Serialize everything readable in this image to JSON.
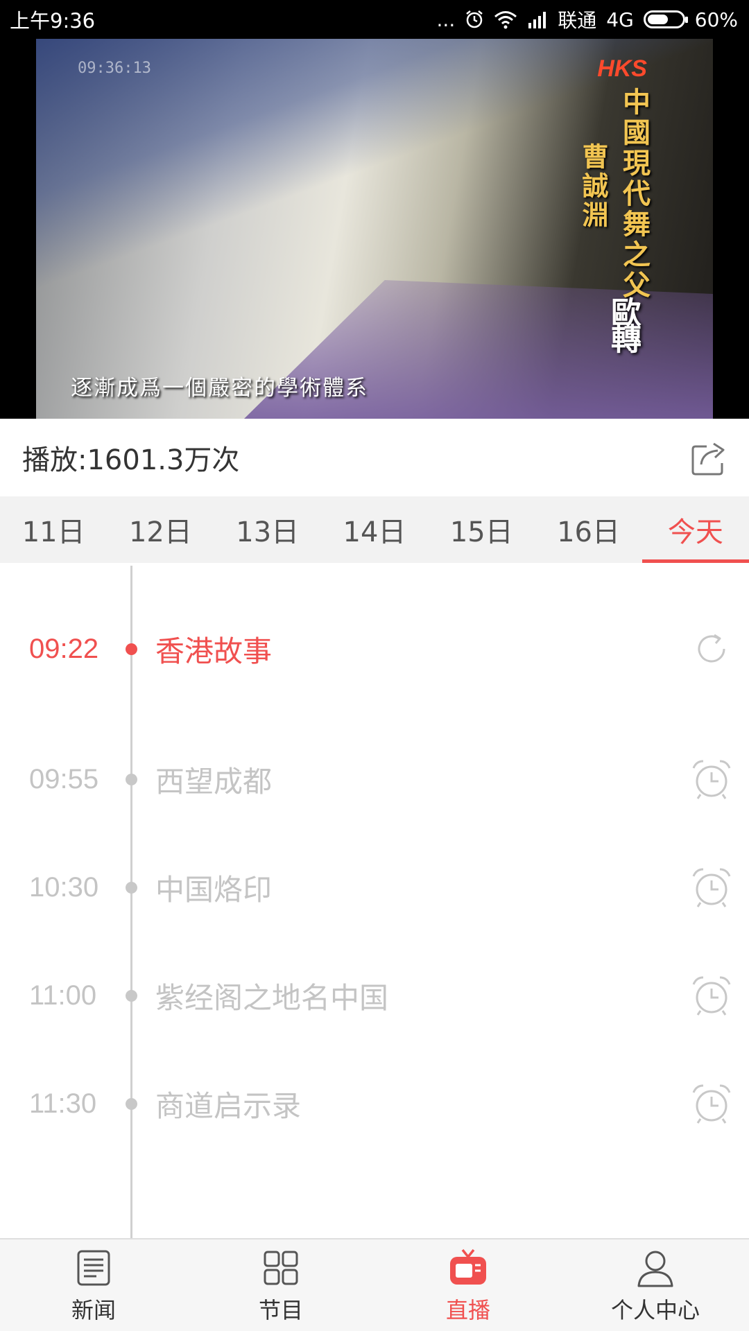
{
  "status_bar": {
    "time": "上午9:36",
    "dots": "...",
    "carrier": "联通",
    "network": "4G",
    "battery_level": 0.6,
    "battery_text": "60%"
  },
  "video": {
    "timestamp": "09:36:13",
    "channel_logo": "HKS",
    "title_text": "中國現代舞之父",
    "name_text": "曹誠淵",
    "show_badge": "歐轉",
    "subtitle": "逐漸成爲一個嚴密的學術體系"
  },
  "info": {
    "play_count": "播放:1601.3万次"
  },
  "date_tabs": [
    {
      "label": "11日"
    },
    {
      "label": "12日"
    },
    {
      "label": "13日"
    },
    {
      "label": "14日"
    },
    {
      "label": "15日"
    },
    {
      "label": "16日"
    },
    {
      "label": "今天",
      "active": true
    }
  ],
  "schedule": [
    {
      "time": "09:22",
      "title": "香港故事",
      "live": true,
      "action": "replay-icon"
    },
    {
      "time": "09:55",
      "title": "西望成都",
      "live": false,
      "action": "alarm-clock-icon"
    },
    {
      "time": "10:30",
      "title": "中国烙印",
      "live": false,
      "action": "alarm-clock-icon"
    },
    {
      "time": "11:00",
      "title": "紫经阁之地名中国",
      "live": false,
      "action": "alarm-clock-icon"
    },
    {
      "time": "11:30",
      "title": "商道启示录",
      "live": false,
      "action": "alarm-clock-icon"
    }
  ],
  "bottom_nav": [
    {
      "label": "新闻",
      "icon": "news-icon",
      "active": false
    },
    {
      "label": "节目",
      "icon": "grid-icon",
      "active": false
    },
    {
      "label": "直播",
      "icon": "tv-icon",
      "active": true
    },
    {
      "label": "个人中心",
      "icon": "person-icon",
      "active": false
    }
  ],
  "colors": {
    "accent": "#f0504f",
    "inactive_text": "#c4c4c4",
    "tab_bar_bg": "#f2f2f2"
  }
}
